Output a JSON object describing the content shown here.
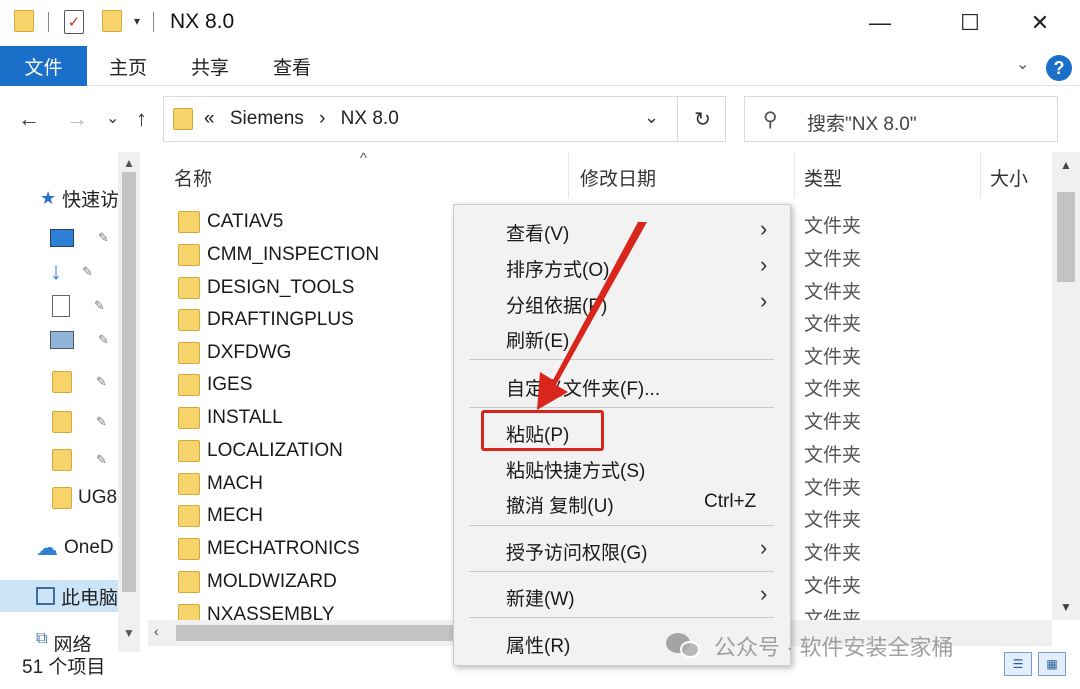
{
  "window": {
    "title": "NX 8.0",
    "minimize_glyph": "—",
    "maximize_glyph": "☐",
    "close_glyph": "✕",
    "quick_access_dropdown": "▾"
  },
  "ribbon": {
    "tabs": [
      {
        "label": "文件",
        "active": true
      },
      {
        "label": "主页"
      },
      {
        "label": "共享"
      },
      {
        "label": "查看"
      }
    ],
    "expand_glyph": "⌄",
    "help_label": "?"
  },
  "navigation": {
    "back_glyph": "←",
    "forward_glyph": "→",
    "recent_glyph": "⌄",
    "up_glyph": "↑",
    "address_prefix": "«",
    "breadcrumb": [
      "Siemens",
      "›",
      "NX 8.0"
    ],
    "address_dropdown_glyph": "⌄",
    "refresh_glyph": "↻",
    "search_placeholder": "搜索\"NX 8.0\""
  },
  "sidebar": {
    "items": [
      {
        "label": "快速访",
        "icon": "star-icon"
      },
      {
        "label": "",
        "icon": "desktop-icon",
        "pinned": true
      },
      {
        "label": "",
        "icon": "download-icon",
        "pinned": true
      },
      {
        "label": "",
        "icon": "document-icon",
        "pinned": true
      },
      {
        "label": "",
        "icon": "picture-icon",
        "pinned": true
      },
      {
        "label": "",
        "icon": "folder-icon",
        "pinned": true
      },
      {
        "label": "",
        "icon": "folder-icon",
        "pinned": true
      },
      {
        "label": "",
        "icon": "folder-icon",
        "pinned": true
      },
      {
        "label": "UG8",
        "icon": "folder-icon"
      },
      {
        "label": "OneD",
        "icon": "cloud-icon"
      },
      {
        "label": "此电脑",
        "icon": "computer-icon",
        "selected": true
      },
      {
        "label": "网络",
        "icon": "network-icon"
      }
    ],
    "pin_glyph": "📌"
  },
  "file_list": {
    "columns": [
      "名称",
      "修改日期",
      "类型",
      "大小"
    ],
    "sort_glyph": "^",
    "rows": [
      {
        "name": "CATIAV5",
        "type": "文件夹"
      },
      {
        "name": "CMM_INSPECTION",
        "type": "文件夹"
      },
      {
        "name": "DESIGN_TOOLS",
        "type": "文件夹"
      },
      {
        "name": "DRAFTINGPLUS",
        "type": "文件夹"
      },
      {
        "name": "DXFDWG",
        "type": "文件夹"
      },
      {
        "name": "IGES",
        "type": "文件夹"
      },
      {
        "name": "INSTALL",
        "type": "文件夹"
      },
      {
        "name": "LOCALIZATION",
        "type": "文件夹"
      },
      {
        "name": "MACH",
        "type": "文件夹"
      },
      {
        "name": "MECH",
        "type": "文件夹"
      },
      {
        "name": "MECHATRONICS",
        "type": "文件夹"
      },
      {
        "name": "MOLDWIZARD",
        "type": "文件夹"
      },
      {
        "name": "NXASSEMBLY",
        "type": "文件夹"
      }
    ]
  },
  "status_bar": {
    "item_count": "51 个项目"
  },
  "context_menu": {
    "items": [
      {
        "label": "查看(V)",
        "submenu": true
      },
      {
        "label": "排序方式(O)",
        "submenu": true
      },
      {
        "label": "分组依据(P)",
        "submenu": true
      },
      {
        "label": "刷新(E)"
      },
      {
        "separator": true
      },
      {
        "label": "自定义文件夹(F)..."
      },
      {
        "separator": true
      },
      {
        "label": "粘贴(P)",
        "highlighted": true
      },
      {
        "label": "粘贴快捷方式(S)"
      },
      {
        "label": "撤消 复制(U)",
        "shortcut": "Ctrl+Z"
      },
      {
        "separator": true
      },
      {
        "label": "授予访问权限(G)",
        "submenu": true
      },
      {
        "separator": true
      },
      {
        "label": "新建(W)",
        "submenu": true
      },
      {
        "separator": true
      },
      {
        "label": "属性(R)"
      }
    ],
    "submenu_glyph": "›"
  },
  "annotation": {
    "color": "#d9261c"
  },
  "watermark": {
    "text": "公众号 · 软件安装全家桶"
  },
  "colors": {
    "accent": "#1a6fc9",
    "folder": "#f7d36b",
    "selection": "#cce4f7",
    "menu_bg": "#f2f2f2"
  }
}
